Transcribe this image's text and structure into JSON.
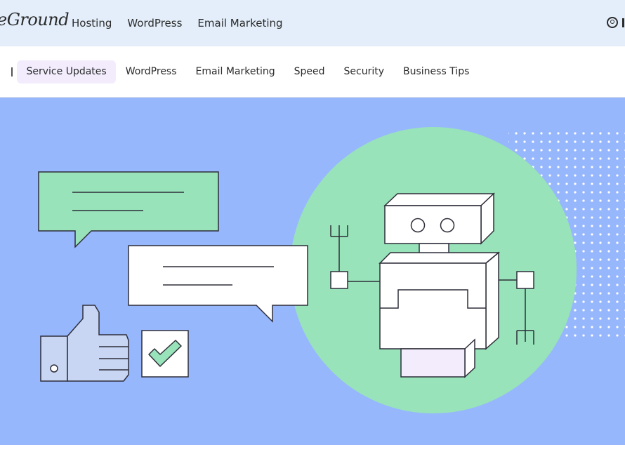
{
  "brand": {
    "logo_text": "eGround"
  },
  "top_nav": {
    "items": [
      "Hosting",
      "WordPress",
      "Email Marketing"
    ]
  },
  "sub_nav": {
    "items": [
      {
        "label": "Service Updates",
        "active": true
      },
      {
        "label": "WordPress",
        "active": false
      },
      {
        "label": "Email Marketing",
        "active": false
      },
      {
        "label": "Speed",
        "active": false
      },
      {
        "label": "Security",
        "active": false
      },
      {
        "label": "Business Tips",
        "active": false
      }
    ]
  },
  "colors": {
    "topbar_bg": "#e3eefa",
    "hero_bg": "#97b7fd",
    "green": "#98e3b9",
    "lavender": "#f2ecfd",
    "thumb": "#c8d6f4",
    "outline": "#2e2e3a"
  },
  "icons": [
    "user-account-icon",
    "thumbs-up-icon",
    "checkmark-icon",
    "robot-illustration",
    "speech-bubble-icon"
  ]
}
